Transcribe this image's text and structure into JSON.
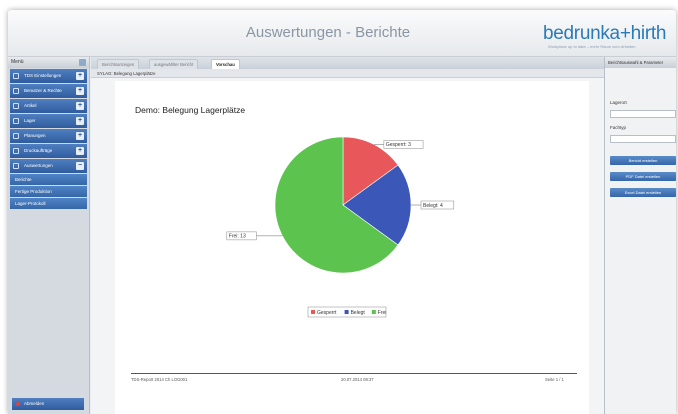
{
  "header": {
    "title": "Auswertungen  -  Berichte",
    "logo_text": "bedrunka",
    "logo_plus": "+",
    "logo_text2": "hirth",
    "logo_tagline": "Workplace up to date – mehr Raum zum Arbeiten"
  },
  "sidebar": {
    "title": "Menü",
    "items": [
      {
        "label": "TDS Einstellungen",
        "icon": "tool-icon"
      },
      {
        "label": "Benutzer & Rechte",
        "icon": "users-icon"
      },
      {
        "label": "Artikel",
        "icon": "box-icon"
      },
      {
        "label": "Lager",
        "icon": "warehouse-icon"
      },
      {
        "label": "Planungen",
        "icon": "calendar-icon"
      },
      {
        "label": "Druckaufträge",
        "icon": "printer-icon"
      },
      {
        "label": "Auswertungen",
        "icon": "chart-icon"
      }
    ],
    "subitems": [
      "Berichte",
      "Fertige Produktion",
      "Lager-Protokoll"
    ],
    "logout": "Abmelden"
  },
  "main": {
    "tabs": [
      "Berichtsanzeigen",
      "ausgewählter Bericht",
      "Vorschau"
    ],
    "report_bar": "SYLAG: Belegung Lagerplätze",
    "report_title": "Demo: Belegung Lagerplätze",
    "footer_left": "TDS-Report 2014 Ch   LOG001",
    "footer_mid": "20.07.2014 08:37",
    "footer_right": "Seite 1 / 1"
  },
  "chart_data": {
    "type": "pie",
    "labels": [
      "Gesperrt",
      "Belegt",
      "Frei"
    ],
    "values": [
      3,
      4,
      13
    ],
    "slice_labels": [
      "Gesperrt: 3",
      "Belegt: 4",
      "Frei: 13"
    ],
    "legend": "bottom",
    "colors": [
      "#e8585a",
      "#3b58b8",
      "#5cc34e"
    ]
  },
  "rpanel": {
    "title": "Berichtsauswahl & Parameter",
    "field1_label": "Lagerort",
    "field2_label": "Fachtyp",
    "btn1": "Bericht erstellen",
    "btn2": "PDF Datei erstellen",
    "btn3": "Excel Datei erstellen"
  }
}
